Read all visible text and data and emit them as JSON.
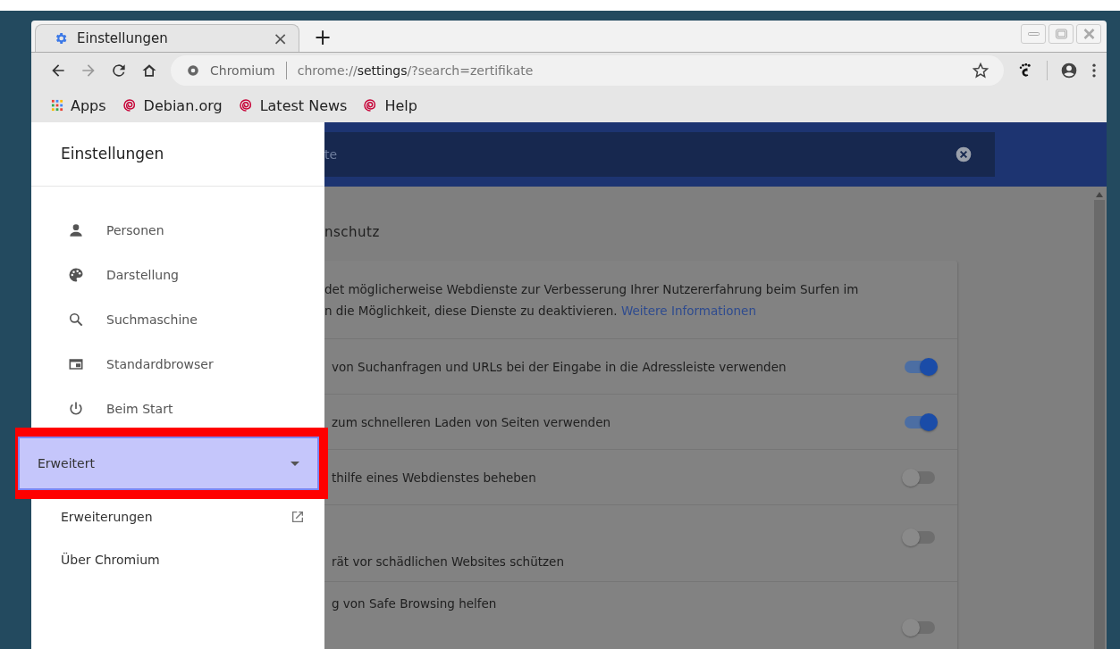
{
  "window": {
    "controls": [
      {
        "kind": "minimize"
      },
      {
        "kind": "maximize"
      },
      {
        "kind": "close"
      }
    ]
  },
  "tabs": [
    {
      "title": "Einstellungen",
      "close": "×",
      "selected": true
    }
  ],
  "new_tab": "+",
  "address_bar": {
    "site": "Chromium",
    "url_before": "chrome://",
    "url_bold": "settings",
    "url_after": "/?search=zertifikate"
  },
  "bookmarks": [
    {
      "label": "Apps",
      "kind": "apps"
    },
    {
      "label": "Debian.org",
      "kind": "debian"
    },
    {
      "label": "Latest News",
      "kind": "debian"
    },
    {
      "label": "Help",
      "kind": "debian"
    }
  ],
  "drawer": {
    "title": "Einstellungen",
    "items": [
      {
        "label": "Personen",
        "kind": "person"
      },
      {
        "label": "Darstellung",
        "kind": "palette"
      },
      {
        "label": "Suchmaschine",
        "kind": "search"
      },
      {
        "label": "Standardbrowser",
        "kind": "browser"
      },
      {
        "label": "Beim Start",
        "kind": "power"
      }
    ],
    "advanced": {
      "label": "Erweitert",
      "expanded": false,
      "highlighted": true
    },
    "links": [
      {
        "label": "Erweiterungen",
        "external": true
      },
      {
        "label": "Über Chromium",
        "external": false
      }
    ]
  },
  "search": {
    "value": "te"
  },
  "section_title": "nschutz",
  "card": {
    "description": [
      "det möglicherweise Webdienste zur Verbesserung Ihrer Nutzererfahrung beim Surfen im",
      "n die Möglichkeit, diese Dienste zu deaktivieren."
    ],
    "link": "Weitere Informationen",
    "rows": [
      {
        "text": "von Suchanfragen und URLs bei der Eingabe in die Adressleiste verwenden",
        "on": true,
        "kind": "single"
      },
      {
        "text": "zum schnelleren Laden von Seiten verwenden",
        "on": true,
        "kind": "single"
      },
      {
        "text": "thilfe eines Webdienstes beheben",
        "on": false,
        "kind": "single"
      },
      {
        "text": "rät vor schädlichen Websites schützen",
        "on": false,
        "kind": "low"
      },
      {
        "text": "g von Safe Browsing helfen",
        "on": false,
        "kind": "top"
      }
    ]
  }
}
